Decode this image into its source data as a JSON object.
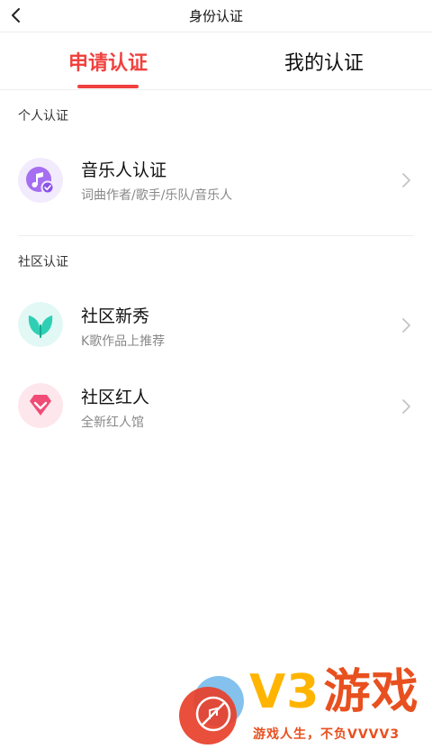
{
  "header": {
    "title": "身份认证",
    "back_icon": "chevron-left-icon"
  },
  "tabs": [
    {
      "label": "申请认证",
      "active": true
    },
    {
      "label": "我的认证",
      "active": false
    }
  ],
  "colors": {
    "accent": "#f0413f",
    "music_icon_bg": "#a66ef0",
    "leaf_icon_bg": "#2fcfb5",
    "gem_icon_bg": "#f04c75"
  },
  "sections": [
    {
      "label": "个人认证",
      "items": [
        {
          "title": "音乐人认证",
          "subtitle": "词曲作者/歌手/乐队/音乐人",
          "icon": "music-badge-icon"
        }
      ]
    },
    {
      "label": "社区认证",
      "items": [
        {
          "title": "社区新秀",
          "subtitle": "K歌作品上推荐",
          "icon": "leaf-icon"
        },
        {
          "title": "社区红人",
          "subtitle": "全新红人馆",
          "icon": "diamond-icon"
        }
      ]
    }
  ],
  "watermark": {
    "brand": "V3",
    "brand_cn": "游戏",
    "slogan": "游戏人生，不负VVVV3"
  }
}
